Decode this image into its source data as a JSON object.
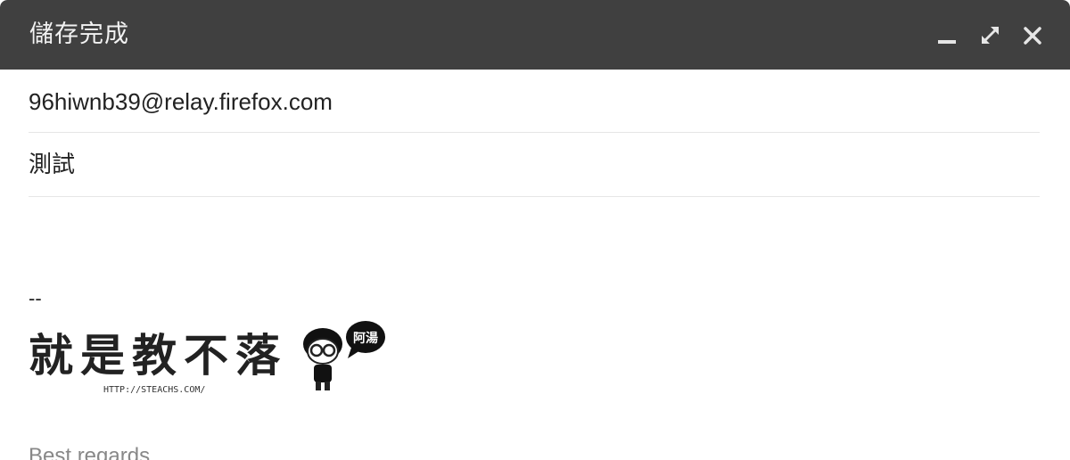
{
  "window": {
    "title": "儲存完成"
  },
  "controls": {
    "minimize": "minimize-icon",
    "expand": "expand-icon",
    "close": "close-icon"
  },
  "compose": {
    "to": "96hiwnb39@relay.firefox.com",
    "subject": "測試",
    "body": {
      "signature_dash": "--",
      "signature_logo": {
        "text": "就是教不落",
        "url": "HTTP://STEACHS.COM/",
        "bubble": "阿湯"
      },
      "closing": "Best regards"
    }
  },
  "colors": {
    "titlebar": "#404040",
    "divider": "#e6e6e6",
    "text": "#222222",
    "muted": "#888888"
  }
}
